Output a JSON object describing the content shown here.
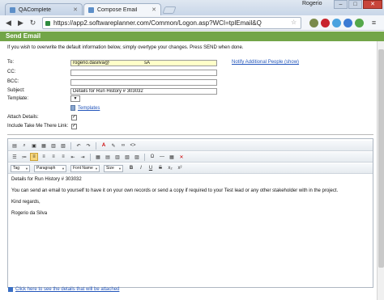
{
  "browser": {
    "tabs": [
      {
        "label": "QAComplete"
      },
      {
        "label": "Compose Email"
      }
    ],
    "user": "Rogerio",
    "address": "https://app2.softwareplanner.com/Common/Logon.asp?WCI=tplEmail&Q"
  },
  "page": {
    "header": "Send Email",
    "intro": "If you wish to overwrite the default information below, simply overtype your changes. Press SEND when done.",
    "to_label": "To:",
    "to_value": "rogerio.dasilva@",
    "to_value_tail": "sA",
    "notify_link": "Notify Additional People (show)",
    "cc_label": "CC:",
    "bcc_label": "BCC:",
    "subject_label": "Subject:",
    "subject_value": "Details for Run History # 303032",
    "template_label": "Template:",
    "templates_link": "Templates",
    "attach_label": "Attach Details:",
    "include_label": "Include Take Me There Link:",
    "attach_checked": true,
    "include_checked": true
  },
  "editor": {
    "dropdowns": {
      "tag": "Tag",
      "paragraph": "Paragraph",
      "font": "Font Name",
      "size": "Size"
    },
    "body": [
      "Details for Run History # 303032",
      "You can send an email to yourself to have it on your own records or send a copy if required to your Test lead or any other stakeholder with in the project.",
      "Kind regards,",
      "Rogerio da Silva"
    ]
  },
  "footer": {
    "link": "Click here to see the details that will be attached"
  }
}
